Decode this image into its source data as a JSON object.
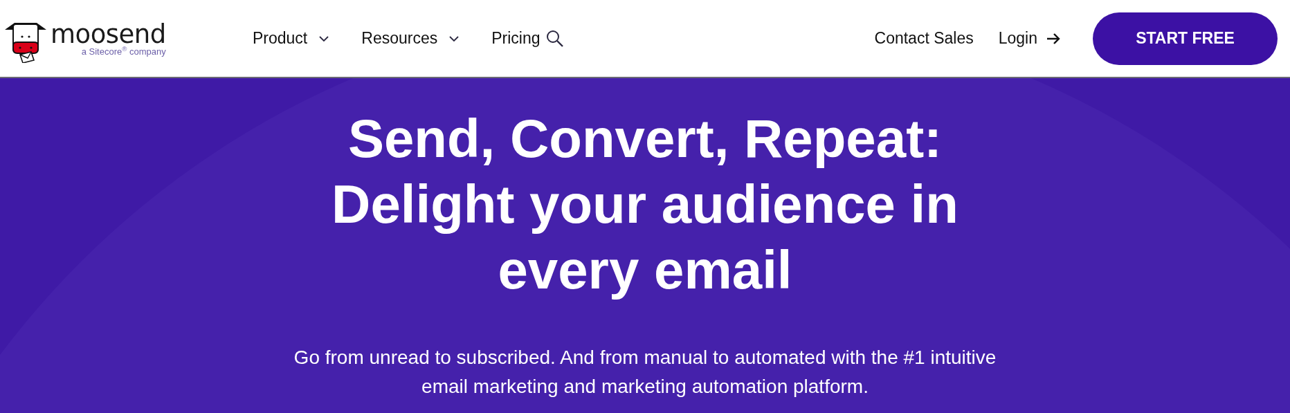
{
  "header": {
    "logo": {
      "wordmark": "moosend",
      "tagline": "a Sitecore",
      "tagline_mark": "®",
      "tagline_end": "company"
    },
    "nav": [
      {
        "label": "Product",
        "dropdown": true
      },
      {
        "label": "Resources",
        "dropdown": true
      },
      {
        "label": "Pricing",
        "dropdown": false
      }
    ],
    "contact": "Contact Sales",
    "login": "Login",
    "cta": "START FREE"
  },
  "hero": {
    "headline": "Send, Convert, Repeat: Delight your audience in every email",
    "subtitle": "Go from unread to subscribed. And from manual to automated with the #1 intuitive email marketing and marketing automation platform."
  }
}
